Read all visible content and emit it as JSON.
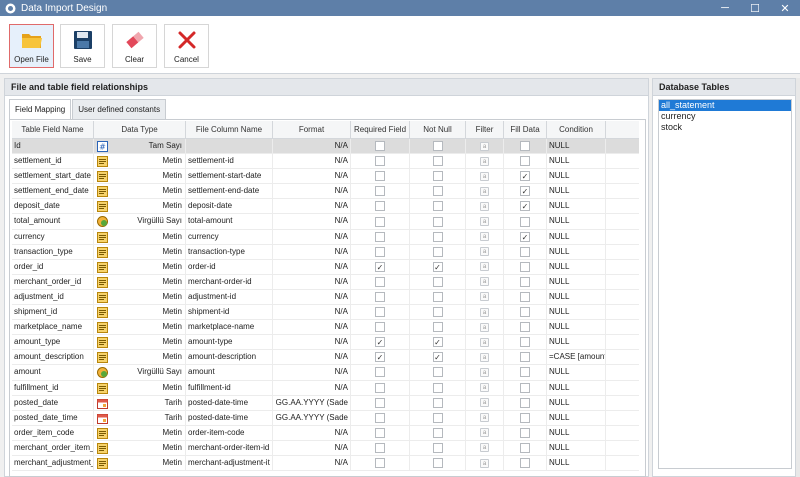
{
  "window": {
    "title": "Data Import Design",
    "controls": {
      "minimize": "─",
      "maximize": "☐",
      "close": "✕"
    }
  },
  "toolbar": {
    "open_label": "Open File",
    "save_label": "Save",
    "clear_label": "Clear",
    "cancel_label": "Cancel"
  },
  "left_panel": {
    "title": "File and table field relationships",
    "tabs": [
      "Field Mapping",
      "User defined constants"
    ]
  },
  "grid": {
    "headers": [
      "Table Field Name",
      "Data Type",
      "File Column Name",
      "Format",
      "Required Field",
      "Not Null",
      "Filter",
      "Fill Data",
      "Condition"
    ],
    "rows": [
      {
        "name": "Id",
        "type": "Tam Sayı",
        "type_icon": "number-icon",
        "file": "",
        "format": "N/A",
        "required": false,
        "notnull": false,
        "fill": false,
        "condition": "NULL"
      },
      {
        "name": "settlement_id",
        "type": "Metin",
        "type_icon": "text-icon",
        "file": "settlement-id",
        "format": "N/A",
        "required": false,
        "notnull": false,
        "fill": false,
        "condition": "NULL"
      },
      {
        "name": "settlement_start_date",
        "type": "Metin",
        "type_icon": "text-icon",
        "file": "settlement-start-date",
        "format": "N/A",
        "required": false,
        "notnull": false,
        "fill": true,
        "condition": "NULL"
      },
      {
        "name": "settlement_end_date",
        "type": "Metin",
        "type_icon": "text-icon",
        "file": "settlement-end-date",
        "format": "N/A",
        "required": false,
        "notnull": false,
        "fill": true,
        "condition": "NULL"
      },
      {
        "name": "deposit_date",
        "type": "Metin",
        "type_icon": "text-icon",
        "file": "deposit-date",
        "format": "N/A",
        "required": false,
        "notnull": false,
        "fill": true,
        "condition": "NULL"
      },
      {
        "name": "total_amount",
        "type": "Virgüllü Sayı",
        "type_icon": "decimal-icon",
        "file": "total-amount",
        "format": "N/A",
        "required": false,
        "notnull": false,
        "fill": false,
        "condition": "NULL"
      },
      {
        "name": "currency",
        "type": "Metin",
        "type_icon": "text-icon",
        "file": "currency",
        "format": "N/A",
        "required": false,
        "notnull": false,
        "fill": true,
        "condition": "NULL"
      },
      {
        "name": "transaction_type",
        "type": "Metin",
        "type_icon": "text-icon",
        "file": "transaction-type",
        "format": "N/A",
        "required": false,
        "notnull": false,
        "fill": false,
        "condition": "NULL"
      },
      {
        "name": "order_id",
        "type": "Metin",
        "type_icon": "text-icon",
        "file": "order-id",
        "format": "N/A",
        "required": true,
        "notnull": true,
        "fill": false,
        "condition": "NULL"
      },
      {
        "name": "merchant_order_id",
        "type": "Metin",
        "type_icon": "text-icon",
        "file": "merchant-order-id",
        "format": "N/A",
        "required": false,
        "notnull": false,
        "fill": false,
        "condition": "NULL"
      },
      {
        "name": "adjustment_id",
        "type": "Metin",
        "type_icon": "text-icon",
        "file": "adjustment-id",
        "format": "N/A",
        "required": false,
        "notnull": false,
        "fill": false,
        "condition": "NULL"
      },
      {
        "name": "shipment_id",
        "type": "Metin",
        "type_icon": "text-icon",
        "file": "shipment-id",
        "format": "N/A",
        "required": false,
        "notnull": false,
        "fill": false,
        "condition": "NULL"
      },
      {
        "name": "marketplace_name",
        "type": "Metin",
        "type_icon": "text-icon",
        "file": "marketplace-name",
        "format": "N/A",
        "required": false,
        "notnull": false,
        "fill": false,
        "condition": "NULL"
      },
      {
        "name": "amount_type",
        "type": "Metin",
        "type_icon": "text-icon",
        "file": "amount-type",
        "format": "N/A",
        "required": true,
        "notnull": true,
        "fill": false,
        "condition": "NULL"
      },
      {
        "name": "amount_description",
        "type": "Metin",
        "type_icon": "text-icon",
        "file": "amount-description",
        "format": "N/A",
        "required": true,
        "notnull": true,
        "fill": false,
        "condition": "=CASE [amount"
      },
      {
        "name": "amount",
        "type": "Virgüllü Sayı",
        "type_icon": "decimal-icon",
        "file": "amount",
        "format": "N/A",
        "required": false,
        "notnull": false,
        "fill": false,
        "condition": "NULL"
      },
      {
        "name": "fulfillment_id",
        "type": "Metin",
        "type_icon": "text-icon",
        "file": "fulfillment-id",
        "format": "N/A",
        "required": false,
        "notnull": false,
        "fill": false,
        "condition": "NULL"
      },
      {
        "name": "posted_date",
        "type": "Tarih",
        "type_icon": "date-icon",
        "file": "posted-date-time",
        "format": "GG.AA.YYYY (Sade",
        "required": false,
        "notnull": false,
        "fill": false,
        "condition": "NULL"
      },
      {
        "name": "posted_date_time",
        "type": "Tarih",
        "type_icon": "date-icon",
        "file": "posted-date-time",
        "format": "GG.AA.YYYY (Sade",
        "required": false,
        "notnull": false,
        "fill": false,
        "condition": "NULL"
      },
      {
        "name": "order_item_code",
        "type": "Metin",
        "type_icon": "text-icon",
        "file": "order-item-code",
        "format": "N/A",
        "required": false,
        "notnull": false,
        "fill": false,
        "condition": "NULL"
      },
      {
        "name": "merchant_order_item_",
        "type": "Metin",
        "type_icon": "text-icon",
        "file": "merchant-order-item-id",
        "format": "N/A",
        "required": false,
        "notnull": false,
        "fill": false,
        "condition": "NULL"
      },
      {
        "name": "merchant_adjustment_",
        "type": "Metin",
        "type_icon": "text-icon",
        "file": "merchant-adjustment-it",
        "format": "N/A",
        "required": false,
        "notnull": false,
        "fill": false,
        "condition": "NULL"
      }
    ],
    "filter_glyph": "a"
  },
  "right_panel": {
    "title": "Database Tables",
    "tables": [
      "all_statement",
      "currency",
      "stock"
    ]
  },
  "colors": {
    "titlebar": "#5e7fa8",
    "selection": "#1f7ad6"
  }
}
